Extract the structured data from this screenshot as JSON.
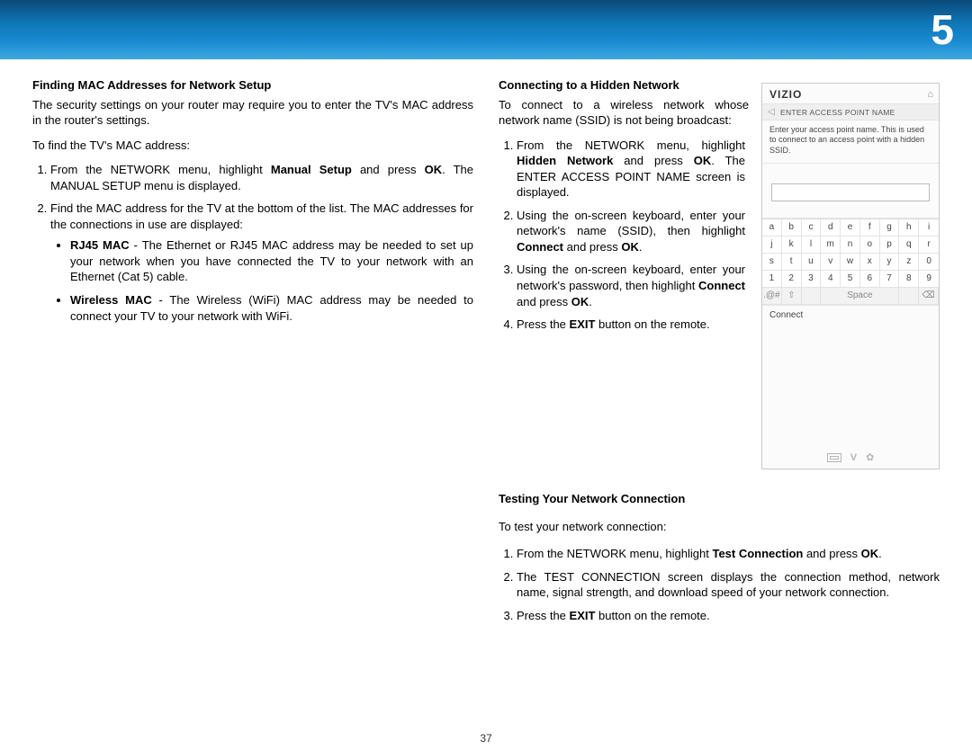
{
  "header": {
    "page_corner_number": "5"
  },
  "footer": {
    "page_number": "37"
  },
  "left": {
    "heading": "Finding MAC Addresses for Network Setup",
    "intro": "The security settings on your router may require you to enter the TV's MAC address in the router's settings.",
    "lead": "To find the TV's MAC address:",
    "step1_a": "From the NETWORK menu, highlight ",
    "step1_b_bold": "Manual Setup",
    "step1_c": " and press ",
    "step1_d_bold": "OK",
    "step1_e": ". The MANUAL SETUP menu is displayed.",
    "step2": "Find the MAC address for the TV at the bottom of the list. The MAC addresses for the connections in use are displayed:",
    "bullet1_label": "RJ45 MAC",
    "bullet1_text": " - The Ethernet or RJ45 MAC address may be needed to set up your network when you have connected the TV to your network with an Ethernet (Cat 5) cable.",
    "bullet2_label": "Wireless MAC",
    "bullet2_text": " - The Wireless (WiFi) MAC address may be needed to connect your TV to your network with WiFi."
  },
  "right": {
    "heading": "Connecting to a Hidden Network",
    "intro": "To connect to a wireless network whose network name (SSID) is not being broadcast:",
    "step1_a": "From the NETWORK menu, highlight ",
    "step1_b_bold": "Hidden Network",
    "step1_c": " and press ",
    "step1_d_bold": "OK",
    "step1_e": ". The ENTER ACCESS POINT NAME screen is displayed.",
    "step2_a": "Using the on-screen keyboard, enter your network's name (SSID), then highlight ",
    "step2_b_bold": "Connect",
    "step2_c": " and press ",
    "step2_d_bold": "OK",
    "step2_e": ".",
    "step3_a": "Using the on-screen keyboard, enter your network's password, then highlight ",
    "step3_b_bold": "Connect",
    "step3_c": " and press ",
    "step3_d_bold": "OK",
    "step3_e": ".",
    "step4_a": "Press the ",
    "step4_b_bold": "EXIT",
    "step4_c": " button on the remote."
  },
  "testing": {
    "heading": "Testing Your Network Connection",
    "lead": "To test your network connection:",
    "step1_a": "From the NETWORK menu, highlight ",
    "step1_b_bold": "Test Connection",
    "step1_c": " and press ",
    "step1_d_bold": "OK",
    "step1_e": ".",
    "step2": "The TEST CONNECTION screen displays the connection method, network name, signal strength, and download speed of your network connection.",
    "step3_a": "Press the ",
    "step3_b_bold": "EXIT",
    "step3_c": " button on the remote."
  },
  "panel": {
    "logo": "VIZIO",
    "subheader": "ENTER ACCESS POINT NAME",
    "description": "Enter your access point name.  This is used to connect to an access point with a hidden SSID.",
    "connect_label": "Connect",
    "keys_row1": [
      "a",
      "b",
      "c",
      "d",
      "e",
      "f",
      "g",
      "h",
      "i"
    ],
    "keys_row2": [
      "j",
      "k",
      "l",
      "m",
      "n",
      "o",
      "p",
      "q",
      "r"
    ],
    "keys_row3": [
      "s",
      "t",
      "u",
      "v",
      "w",
      "x",
      "y",
      "z",
      "0"
    ],
    "keys_row4": [
      "1",
      "2",
      "3",
      "4",
      "5",
      "6",
      "7",
      "8",
      "9"
    ],
    "sym_key": ".@#",
    "shift_key": "⇧",
    "space_key": "Space",
    "back_key": "⌫",
    "empty_key": ""
  }
}
